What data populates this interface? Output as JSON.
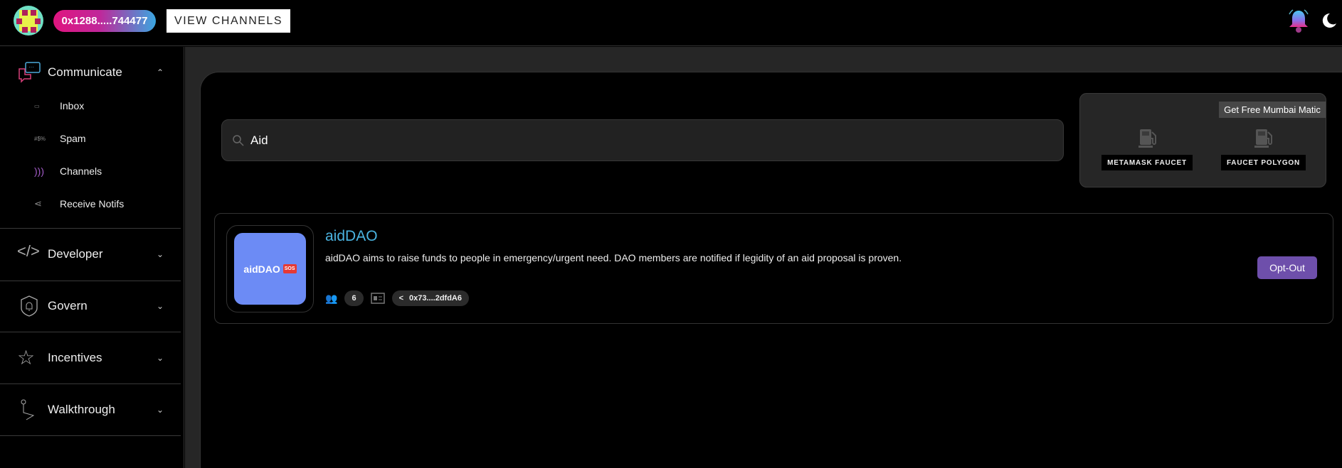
{
  "header": {
    "address": "0x1288.....744477",
    "view_channels_label": "VIEW CHANNELS"
  },
  "sidebar": {
    "communicate": {
      "label": "Communicate",
      "items": [
        {
          "label": "Inbox"
        },
        {
          "label": "Spam",
          "icon_text": "#$%"
        },
        {
          "label": "Channels"
        },
        {
          "label": "Receive Notifs"
        }
      ]
    },
    "sections": [
      {
        "label": "Developer"
      },
      {
        "label": "Govern"
      },
      {
        "label": "Incentives"
      },
      {
        "label": "Walkthrough"
      }
    ]
  },
  "search": {
    "value": "Aid"
  },
  "faucet": {
    "title": "Get Free Mumbai Matic",
    "buttons": [
      "METAMASK FAUCET",
      "FAUCET POLYGON"
    ]
  },
  "channel": {
    "name": "aidDAO",
    "logo_text": "aidDAO",
    "logo_badge": "SOS",
    "description": "aidDAO aims to raise funds to people in emergency/urgent need. DAO members are notified if legidity of an aid proposal is proven.",
    "subscribers": "6",
    "address": "0x73....2dfdA6",
    "action_label": "Opt-Out"
  },
  "colors": {
    "accent": "#6e4fab",
    "title": "#4ab3e0",
    "logo_bg": "#6c8bf5"
  }
}
